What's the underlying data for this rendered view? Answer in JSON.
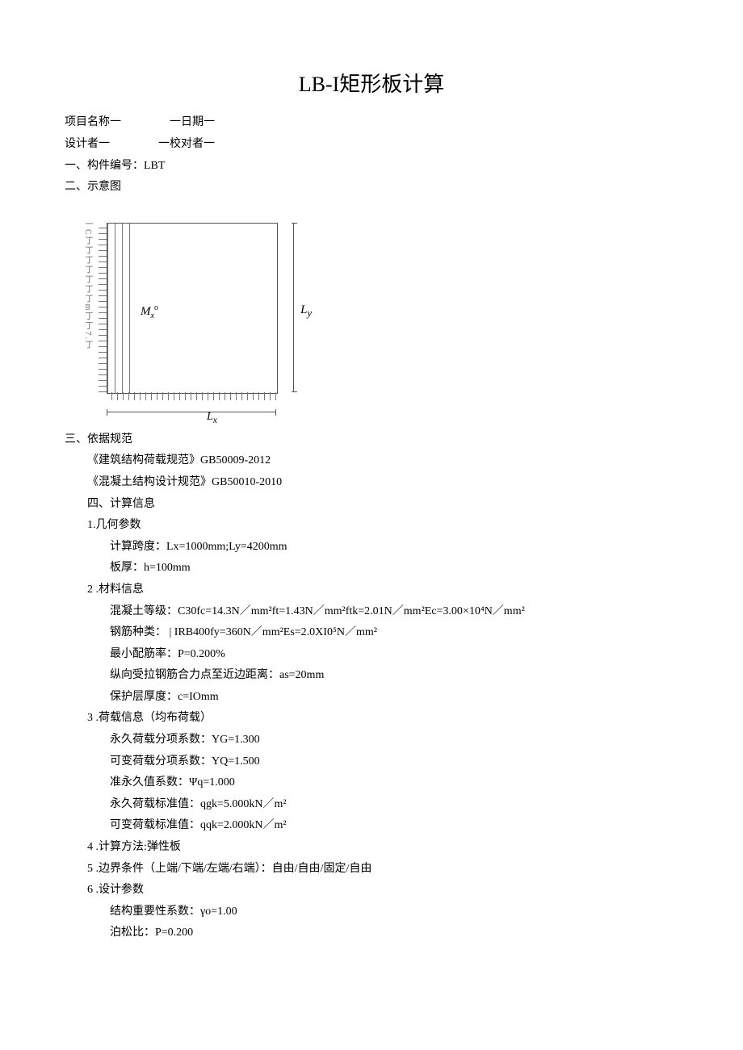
{
  "title": "LB-I矩形板计算",
  "meta": {
    "row1_left": "项目名称一",
    "row1_right": "一日期一",
    "row2_left": "设计者一",
    "row2_right": "一校对者一"
  },
  "sections": {
    "s1": "一、构件编号：LBT",
    "s2": "二、示意图",
    "s3": "三、依据规范",
    "s3_a": "《建筑结构荷载规范》GB50009-2012",
    "s3_b": "《混凝土结构设计规范》GB50010-2010",
    "s4": "四、计算信息",
    "p1": "1.几何参数",
    "p1_a": "计算跨度：Lx=1000mm;Ly=4200mm",
    "p1_b": "板厚：h=100mm",
    "p2": "2 .材料信息",
    "p2_a": "混凝土等级：C30fc=14.3N／mm²ft=1.43N／mm²ftk=2.01N／mm²Ec=3.00×10⁴N／mm²",
    "p2_b": "钢筋种类： | IRB400fy=360N／mm²Es=2.0XI0⁵N／mm²",
    "p2_c": "最小配筋率：P=0.200%",
    "p2_d": "纵向受拉钢筋合力点至近边距离：as=20mm",
    "p2_e": "保护层厚度：c=IOmm",
    "p3": "3 .荷载信息（均布荷载）",
    "p3_a": "永久荷载分项系数：YG=1.300",
    "p3_b": "可变荷载分项系数：YQ=1.500",
    "p3_c": "准永久值系数：Ψq=1.000",
    "p3_d": "永久荷载标准值：qgk=5.000kN／m²",
    "p3_e": "可变荷载标准值：qqk=2.000kN／m²",
    "p4": "4 .计算方法:弹性板",
    "p5": "5 .边界条件（上端/下端/左端/右端）：自由/自由/固定/自由",
    "p6": "6 .设计参数",
    "p6_a": "结构重要性系数：γo=1.00",
    "p6_b": "泊松比：P=0.200"
  },
  "diagram": {
    "mx": "M",
    "mx_sub": "x",
    "mx_sup": "o",
    "ly": "L",
    "ly_sub": "y",
    "lx": "L",
    "lx_sub": "x",
    "yaxis": "一C丁丁丁丁丁丁丁m丁丁7.丁"
  }
}
